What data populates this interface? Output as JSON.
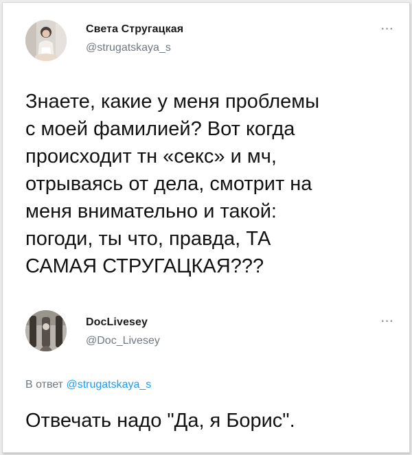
{
  "tweet1": {
    "author_name": "Света Стругацкая",
    "author_handle": "@strugatskaya_s",
    "more_icon": "more-dots-icon",
    "text": "Знаете, какие у меня проблемы\nс моей фамилией? Вот когда\nпроисходит тн «секс» и мч,\nотрываясь от дела, смотрит на\nменя внимательно и такой:\nпогоди, ты что, правда, ТА\nСАМАЯ СТРУГАЦКАЯ???"
  },
  "tweet2": {
    "author_name": "DocLivesey",
    "author_handle": "@Doc_Livesey",
    "more_icon": "more-dots-icon",
    "reply_prefix": "В ответ ",
    "reply_mention": "@strugatskaya_s",
    "text": "Отвечать надо \"Да, я Борис\"."
  },
  "colors": {
    "mention": "#1d9bf0",
    "secondary_text": "#6f7780",
    "primary_text": "#111111"
  }
}
